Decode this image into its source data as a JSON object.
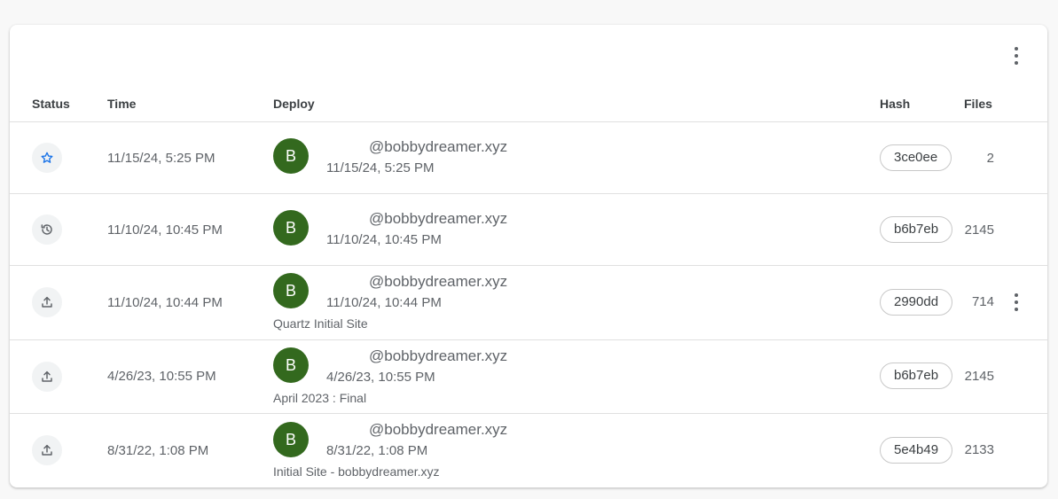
{
  "columns": {
    "status": "Status",
    "time": "Time",
    "deploy": "Deploy",
    "hash": "Hash",
    "files": "Files"
  },
  "deploys": [
    {
      "status_icon": "star-icon",
      "time": "11/15/24, 5:25 PM",
      "avatar": "B",
      "user": "@bobbydreamer.xyz",
      "deploy_time": "11/15/24, 5:25 PM",
      "message": "",
      "hash": "3ce0ee",
      "files": "2"
    },
    {
      "status_icon": "history-icon",
      "time": "11/10/24, 10:45 PM",
      "avatar": "B",
      "user": "@bobbydreamer.xyz",
      "deploy_time": "11/10/24, 10:45 PM",
      "message": "",
      "hash": "b6b7eb",
      "files": "2145"
    },
    {
      "status_icon": "upload-icon",
      "time": "11/10/24, 10:44 PM",
      "avatar": "B",
      "user": "@bobbydreamer.xyz",
      "deploy_time": "11/10/24, 10:44 PM",
      "message": "Quartz Initial Site",
      "hash": "2990dd",
      "files": "714"
    },
    {
      "status_icon": "upload-icon",
      "time": "4/26/23, 10:55 PM",
      "avatar": "B",
      "user": "@bobbydreamer.xyz",
      "deploy_time": "4/26/23, 10:55 PM",
      "message": "April 2023 : Final",
      "hash": "b6b7eb",
      "files": "2145"
    },
    {
      "status_icon": "upload-icon",
      "time": "8/31/22, 1:08 PM",
      "avatar": "B",
      "user": "@bobbydreamer.xyz",
      "deploy_time": "8/31/22, 1:08 PM",
      "message": "Initial Site - bobbydreamer.xyz",
      "hash": "5e4b49",
      "files": "2133"
    }
  ],
  "colors": {
    "avatar_bg": "#33691e",
    "star_icon": "#1a73e8",
    "icon_gray": "#5f6368"
  }
}
